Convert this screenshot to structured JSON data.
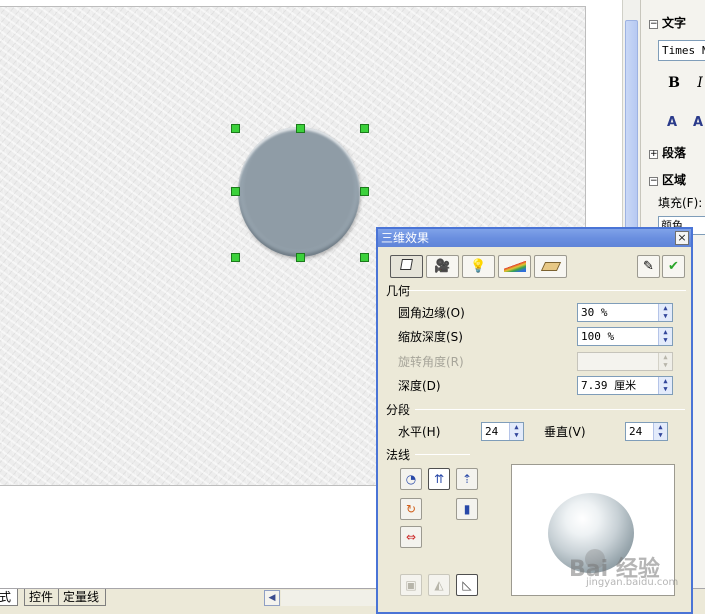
{
  "sidebar": {
    "text_section_label": "文字",
    "font_name": "Times N",
    "bold_label": "B",
    "italic_label": "I",
    "shadow_label": "A",
    "outline_label": "A",
    "paragraph_section_label": "段落",
    "area_section_label": "区域",
    "fill_label": "填充(F):",
    "fill_value": "颜色",
    "collapse_symbol": "−",
    "expand_symbol": "+"
  },
  "bottom_tabs": {
    "layout": "式",
    "controls": "控件",
    "guides": "定量线"
  },
  "dialog": {
    "title": "三维效果",
    "close_symbol": "×",
    "apply_symbol": "✔",
    "geometry": {
      "title": "几何",
      "rounded_edges_label": "圆角边缘(O)",
      "rounded_edges_value": "30 %",
      "scaled_depth_label": "缩放深度(S)",
      "scaled_depth_value": "100 %",
      "rotation_angle_label": "旋转角度(R)",
      "rotation_angle_value": "",
      "depth_label": "深度(D)",
      "depth_value": "7.39 厘米"
    },
    "segments": {
      "title": "分段",
      "horizontal_label": "水平(H)",
      "horizontal_value": "24",
      "vertical_label": "垂直(V)",
      "vertical_value": "24"
    },
    "normals": {
      "title": "法线"
    },
    "watermark": "Bai 经验",
    "watermark_sub": "jingyan.baidu.com"
  },
  "colors": {
    "dialog_title_blue": "#6a8fe0",
    "handle_green": "#3bd13b",
    "shape_fill": "#8f9ca6"
  }
}
